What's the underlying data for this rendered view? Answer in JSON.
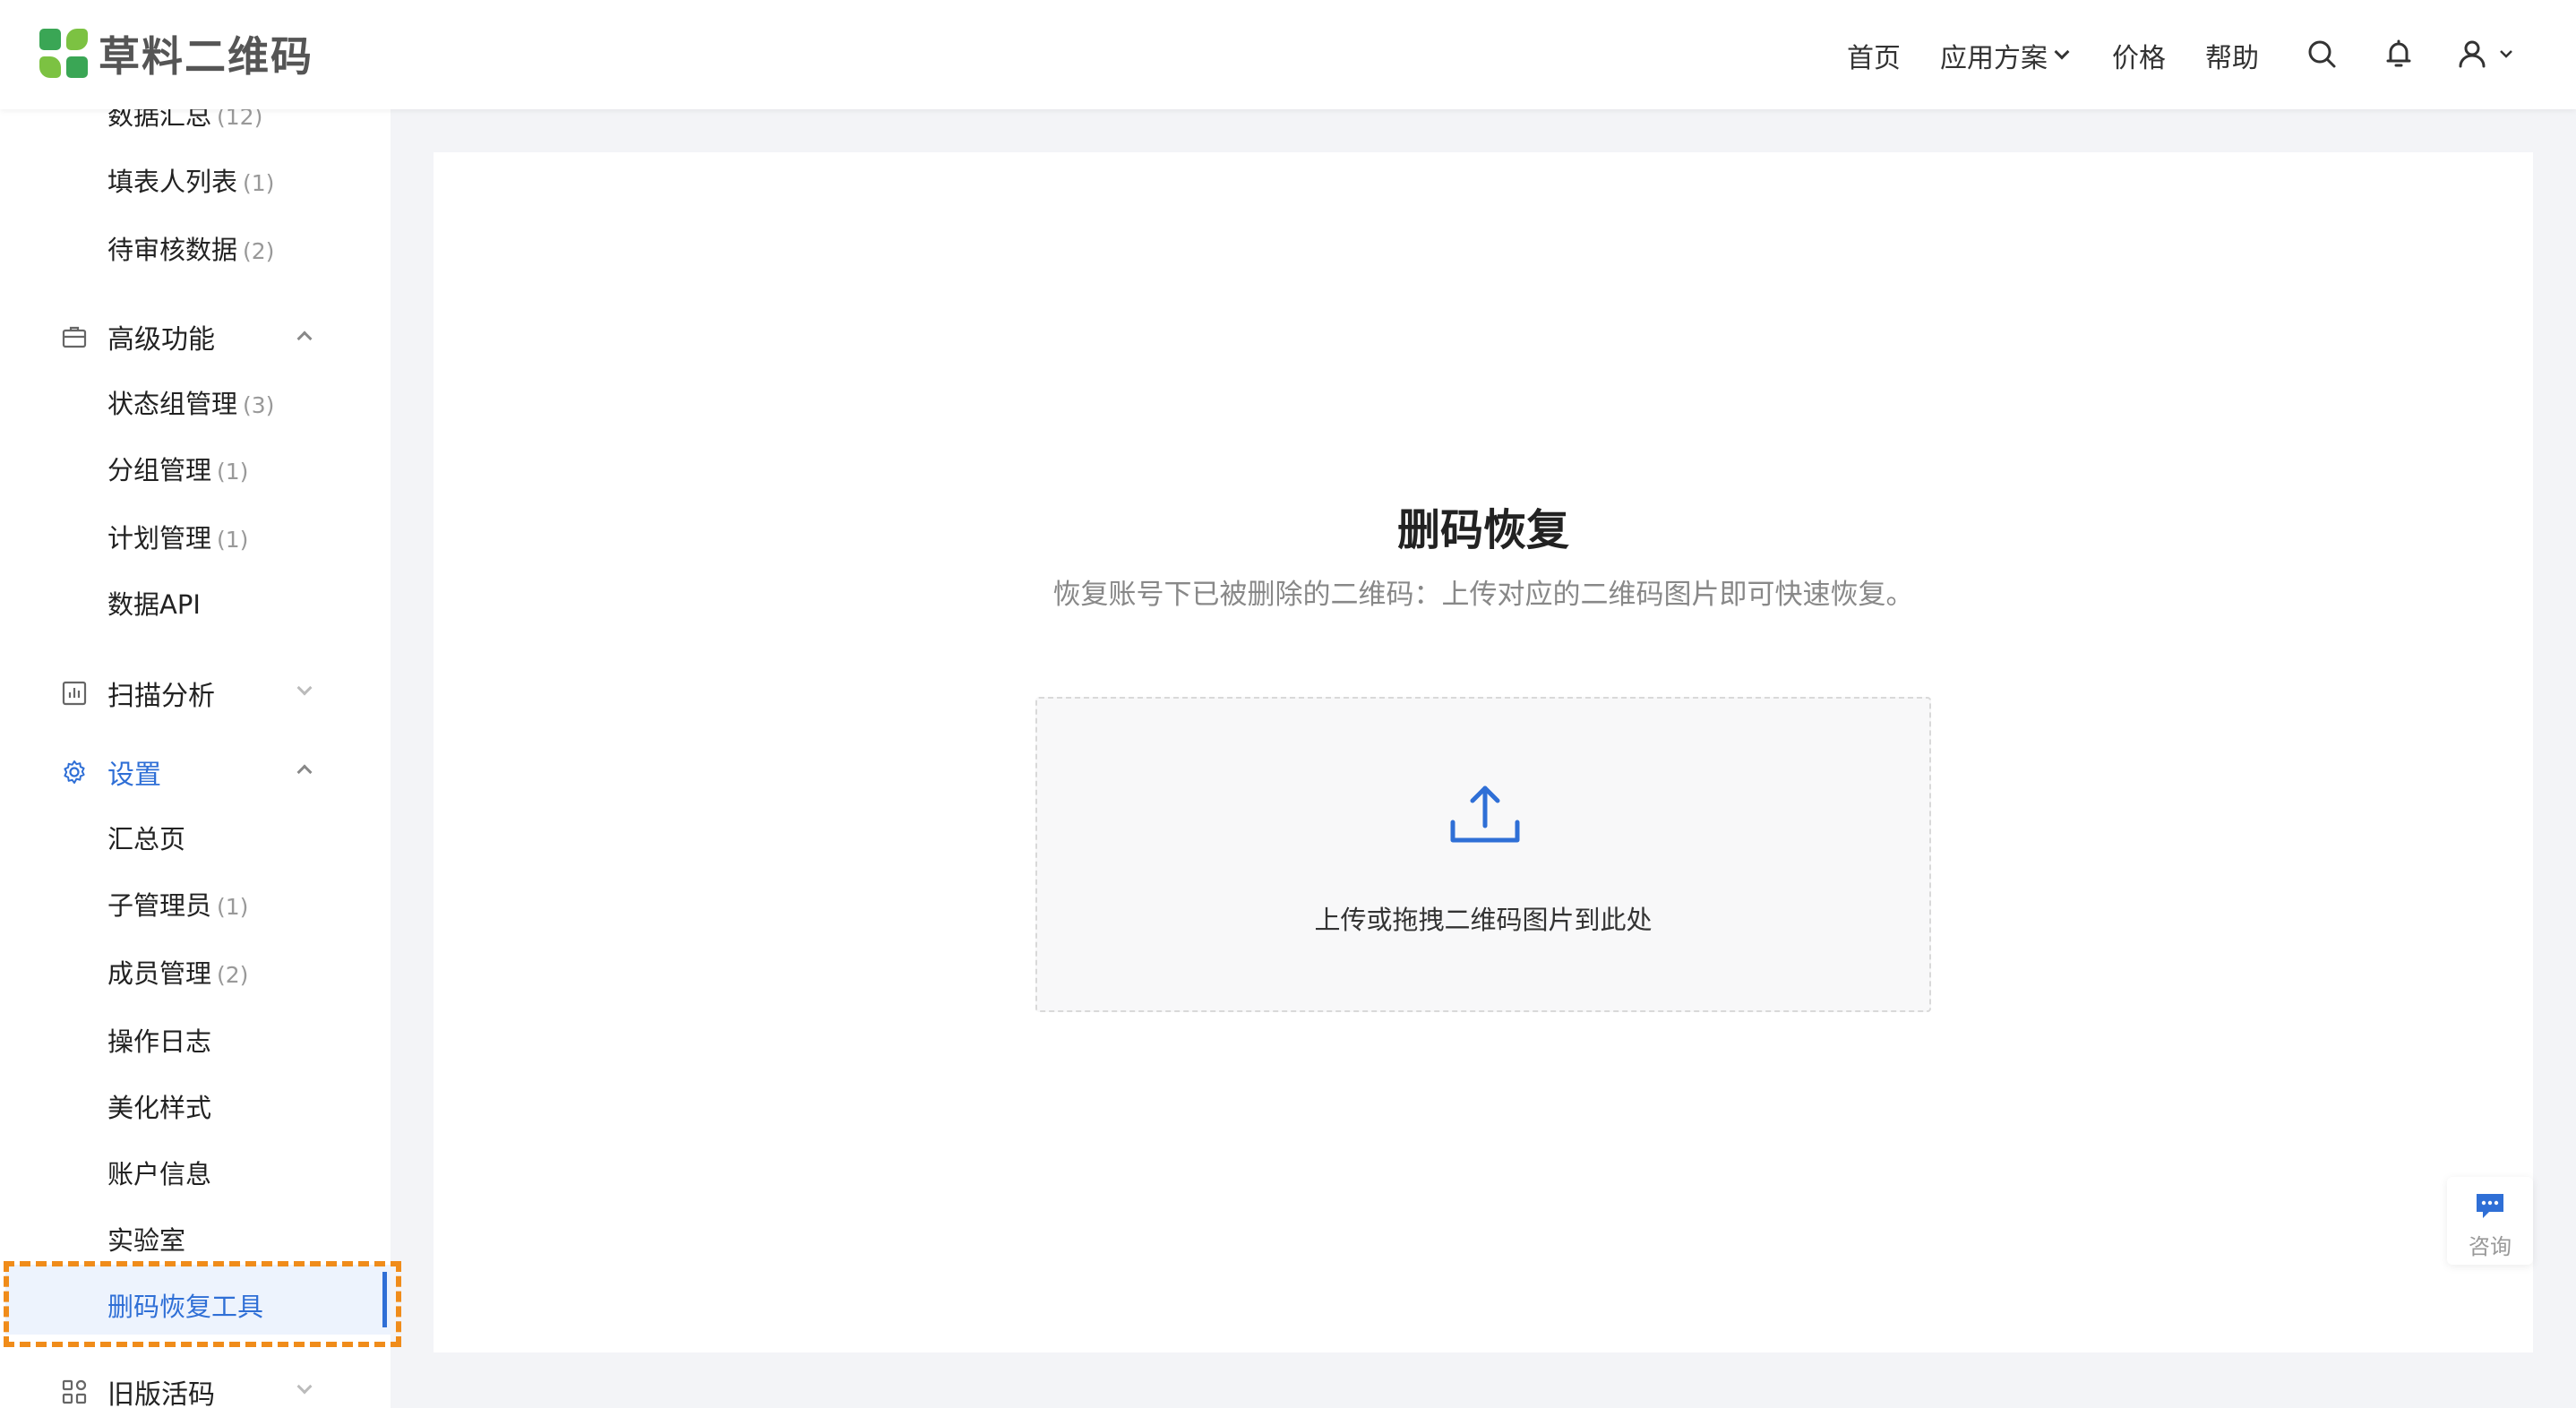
{
  "header": {
    "logo_text": "草料二维码",
    "nav": {
      "home": "首页",
      "solutions": "应用方案",
      "pricing": "价格",
      "help": "帮助"
    }
  },
  "sidebar": {
    "items_top": [
      {
        "label": "数据汇总",
        "count": "(12)"
      },
      {
        "label": "填表人列表",
        "count": "(1)"
      },
      {
        "label": "待审核数据",
        "count": "(2)"
      }
    ],
    "advanced": {
      "label": "高级功能",
      "items": [
        {
          "label": "状态组管理",
          "count": "(3)"
        },
        {
          "label": "分组管理",
          "count": "(1)"
        },
        {
          "label": "计划管理",
          "count": "(1)"
        },
        {
          "label": "数据API",
          "count": ""
        }
      ]
    },
    "scan_analysis": {
      "label": "扫描分析"
    },
    "settings": {
      "label": "设置",
      "items": [
        {
          "label": "汇总页",
          "count": ""
        },
        {
          "label": "子管理员",
          "count": "(1)"
        },
        {
          "label": "成员管理",
          "count": "(2)"
        },
        {
          "label": "操作日志",
          "count": ""
        },
        {
          "label": "美化样式",
          "count": ""
        },
        {
          "label": "账户信息",
          "count": ""
        },
        {
          "label": "实验室",
          "count": ""
        },
        {
          "label": "删码恢复工具",
          "count": ""
        }
      ]
    },
    "legacy": {
      "label": "旧版活码"
    }
  },
  "main": {
    "title": "删码恢复",
    "description": "恢复账号下已被删除的二维码：上传对应的二维码图片即可快速恢复。",
    "upload_text": "上传或拖拽二维码图片到此处"
  },
  "consult": {
    "label": "咨询"
  },
  "colors": {
    "accent": "#2f6fd6",
    "highlight": "#f08c1a",
    "logo_dark": "#3aa655",
    "logo_light": "#7cc242"
  }
}
